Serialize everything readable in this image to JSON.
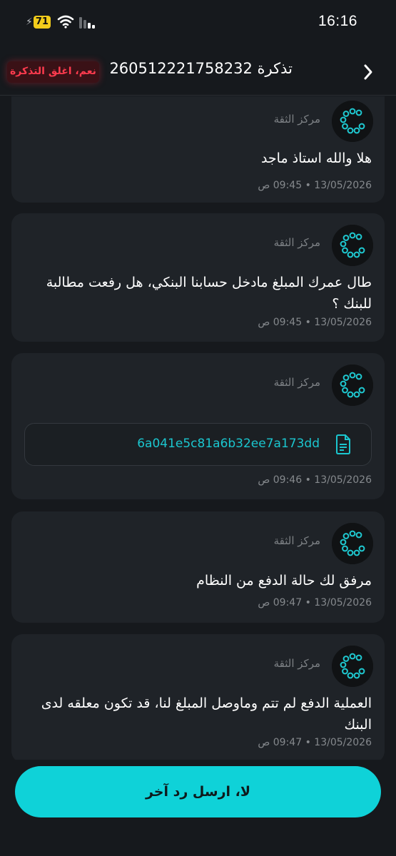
{
  "status_bar": {
    "time": "16:16",
    "battery": "71"
  },
  "header": {
    "title": "تذكرة 260512221758232",
    "close_ticket_label": "نعم، اغلق التذكرة"
  },
  "messages": [
    {
      "sender": "مركز الثقة",
      "text": "هلا والله استاذ ماجد",
      "timestamp": "13/05/2026 • 09:45 ص"
    },
    {
      "sender": "مركز الثقة",
      "text": "طال عمرك المبلغ مادخل حسابنا البنكي، هل رفعت مطالبة للبنك ؟",
      "timestamp": "13/05/2026 • 09:45 ص"
    },
    {
      "sender": "مركز الثقة",
      "attachment": "6a041e5c81a6b32ee7a173dd",
      "timestamp": "13/05/2026 • 09:46 ص"
    },
    {
      "sender": "مركز الثقة",
      "text": "مرفق لك حالة الدفع من النظام",
      "timestamp": "13/05/2026 • 09:47 ص"
    },
    {
      "sender": "مركز الثقة",
      "text": "العملية الدفع لم تتم وماوصل المبلغ لنا، قد تكون معلقه لدى البنك",
      "timestamp": "13/05/2026 • 09:47 ص"
    }
  ],
  "reply_button_label": "لا، ارسل رد آخر",
  "colors": {
    "accent": "#0fd2d8",
    "danger": "#ff3b4e",
    "card": "#1f2328",
    "background": "#16191d"
  }
}
